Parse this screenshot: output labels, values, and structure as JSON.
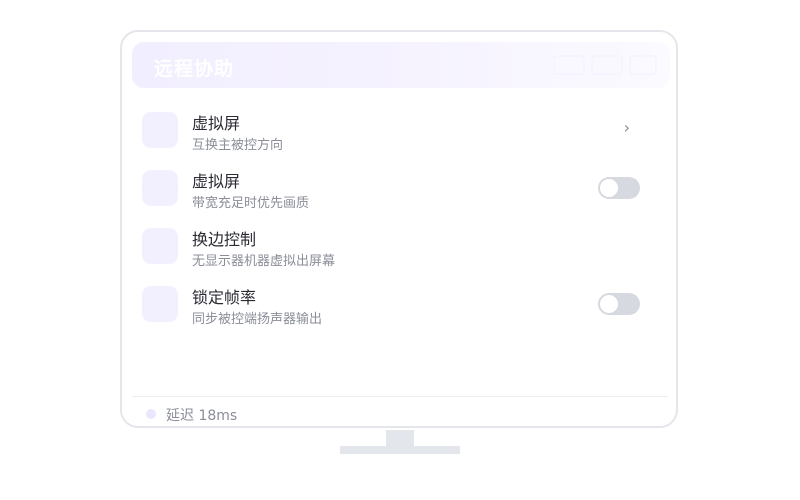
{
  "header": {
    "title": "远程协助"
  },
  "settings": [
    {
      "title": "虚拟屏",
      "subtitle": "互换主被控方向",
      "control": "chevron",
      "chevron": "›"
    },
    {
      "title": "虚拟屏",
      "subtitle": "带宽充足时优先画质",
      "control": "toggle",
      "on": false
    },
    {
      "title": "换边控制",
      "subtitle": "无显示器机器虚拟出屏幕",
      "control": "none"
    },
    {
      "title": "锁定帧率",
      "subtitle": "同步被控端扬声器输出",
      "control": "toggle",
      "on": false
    }
  ],
  "status": {
    "text": "延迟 18ms"
  },
  "colors": {
    "accent_light": "#f2f0ff",
    "toggle_off": "#d7d9e0",
    "border": "#e4e6ec"
  }
}
